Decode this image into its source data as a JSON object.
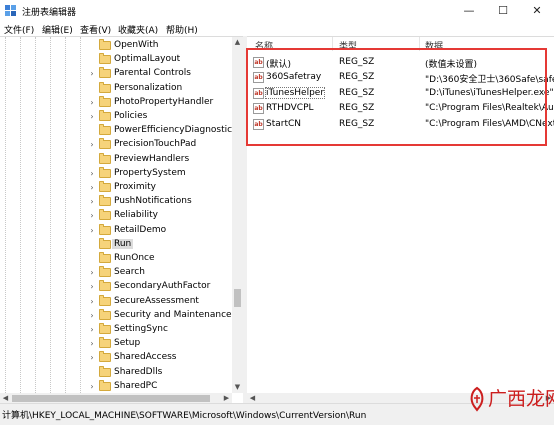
{
  "window": {
    "title": "注册表编辑器",
    "controls": {
      "minimize": "—",
      "maximize": "☐",
      "close": "✕"
    }
  },
  "menu": [
    "文件(F)",
    "编辑(E)",
    "查看(V)",
    "收藏夹(A)",
    "帮助(H)"
  ],
  "tree": {
    "items": [
      {
        "label": "OpenWith",
        "expandable": false
      },
      {
        "label": "OptimalLayout",
        "expandable": false
      },
      {
        "label": "Parental Controls",
        "expandable": true
      },
      {
        "label": "Personalization",
        "expandable": false
      },
      {
        "label": "PhotoPropertyHandler",
        "expandable": true
      },
      {
        "label": "Policies",
        "expandable": true
      },
      {
        "label": "PowerEfficiencyDiagnostics",
        "expandable": false
      },
      {
        "label": "PrecisionTouchPad",
        "expandable": true
      },
      {
        "label": "PreviewHandlers",
        "expandable": false
      },
      {
        "label": "PropertySystem",
        "expandable": true
      },
      {
        "label": "Proximity",
        "expandable": true
      },
      {
        "label": "PushNotifications",
        "expandable": true
      },
      {
        "label": "Reliability",
        "expandable": true
      },
      {
        "label": "RetailDemo",
        "expandable": true
      },
      {
        "label": "Run",
        "expandable": false,
        "selected": true
      },
      {
        "label": "RunOnce",
        "expandable": false
      },
      {
        "label": "Search",
        "expandable": true
      },
      {
        "label": "SecondaryAuthFactor",
        "expandable": true
      },
      {
        "label": "SecureAssessment",
        "expandable": true
      },
      {
        "label": "Security and Maintenance",
        "expandable": true
      },
      {
        "label": "SettingSync",
        "expandable": true
      },
      {
        "label": "Setup",
        "expandable": true
      },
      {
        "label": "SharedAccess",
        "expandable": true
      },
      {
        "label": "SharedDlls",
        "expandable": false
      },
      {
        "label": "SharedPC",
        "expandable": true
      }
    ]
  },
  "list": {
    "columns": {
      "name": "名称",
      "type": "类型",
      "data": "数据"
    },
    "rows": [
      {
        "name": "(默认)",
        "type": "REG_SZ",
        "data": "(数值未设置)"
      },
      {
        "name": "360Safetray",
        "type": "REG_SZ",
        "data": "\"D:\\360安全卫士\\360Safe\\safem"
      },
      {
        "name": "iTunesHelper",
        "type": "REG_SZ",
        "data": "\"D:\\iTunes\\iTunesHelper.exe\""
      },
      {
        "name": "RTHDVCPL",
        "type": "REG_SZ",
        "data": "\"C:\\Program Files\\Realtek\\Audi"
      },
      {
        "name": "StartCN",
        "type": "REG_SZ",
        "data": "\"C:\\Program Files\\AMD\\CNext\\"
      }
    ],
    "value_icon": "ab"
  },
  "status": {
    "path": "计算机\\HKEY_LOCAL_MACHINE\\SOFTWARE\\Microsoft\\Windows\\CurrentVersion\\Run"
  },
  "watermark": {
    "text": "广西龙网"
  },
  "colors": {
    "highlight": "#e53935",
    "folder": "#f6d37a",
    "watermark": "#cc1f1f"
  }
}
